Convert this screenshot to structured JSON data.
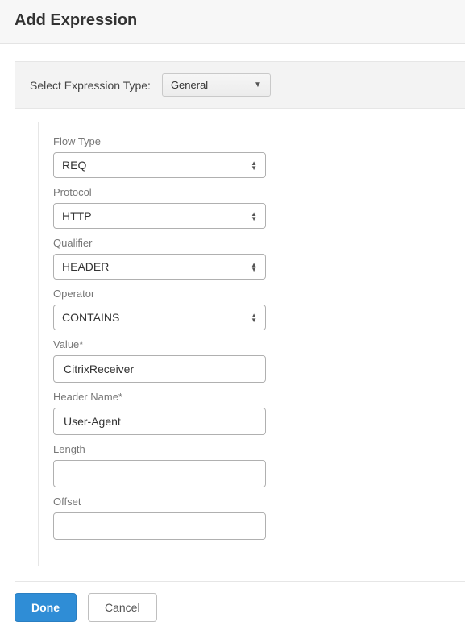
{
  "title": "Add Expression",
  "type_row": {
    "label": "Select Expression Type:",
    "value": "General"
  },
  "fields": {
    "flow_type": {
      "label": "Flow Type",
      "value": "REQ"
    },
    "protocol": {
      "label": "Protocol",
      "value": "HTTP"
    },
    "qualifier": {
      "label": "Qualifier",
      "value": "HEADER"
    },
    "operator": {
      "label": "Operator",
      "value": "CONTAINS"
    },
    "value": {
      "label": "Value*",
      "value": "CitrixReceiver"
    },
    "header_name": {
      "label": "Header Name*",
      "value": "User-Agent"
    },
    "length": {
      "label": "Length",
      "value": ""
    },
    "offset": {
      "label": "Offset",
      "value": ""
    }
  },
  "buttons": {
    "done": "Done",
    "cancel": "Cancel"
  }
}
